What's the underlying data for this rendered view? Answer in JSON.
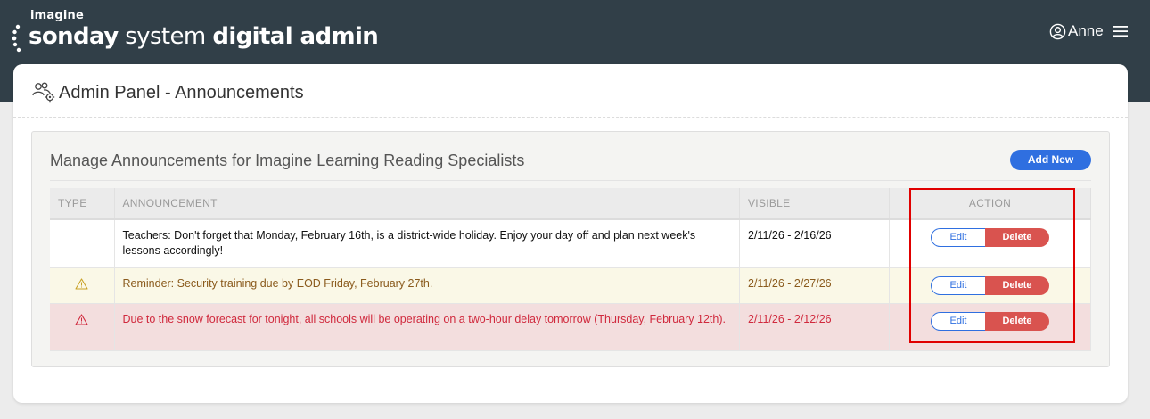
{
  "header": {
    "logo_small": "imagine",
    "logo_word1": "sonday",
    "logo_word2": "system",
    "logo_word3": "digital admin",
    "user_name": "Anne",
    "icons": [
      "account-circle-icon",
      "hamburger-menu-icon"
    ]
  },
  "page": {
    "title": "Admin Panel - Announcements",
    "title_icon": "users-gear-icon"
  },
  "panel": {
    "title": "Manage Announcements for Imagine Learning Reading Specialists",
    "add_button": "Add New"
  },
  "table": {
    "columns": [
      "TYPE",
      "ANNOUNCEMENT",
      "VISIBLE",
      "ACTION"
    ],
    "rows": [
      {
        "type": "normal",
        "announcement": "Teachers: Don't forget that Monday, February 16th, is a district-wide holiday. Enjoy your day off and plan next week's lessons accordingly!",
        "visible": "2/11/26 - 2/16/26",
        "edit": "Edit",
        "delete": "Delete"
      },
      {
        "type": "warning",
        "announcement": "Reminder: Security training due by EOD Friday, February 27th.",
        "visible": "2/11/26 - 2/27/26",
        "edit": "Edit",
        "delete": "Delete"
      },
      {
        "type": "danger",
        "announcement": "Due to the snow forecast for tonight, all schools will be operating on a two-hour delay tomorrow (Thursday, February 12th).",
        "visible": "2/11/26 - 2/12/26",
        "edit": "Edit",
        "delete": "Delete"
      }
    ]
  },
  "colors": {
    "topbar": "#313f48",
    "primary": "#2f6fe0",
    "delete": "#d9534f",
    "warning_row": "#faf8e7",
    "warning_text": "#8a5a1c",
    "danger_row": "#f3dede",
    "danger_text": "#d0293d",
    "highlight": "#e00000"
  }
}
